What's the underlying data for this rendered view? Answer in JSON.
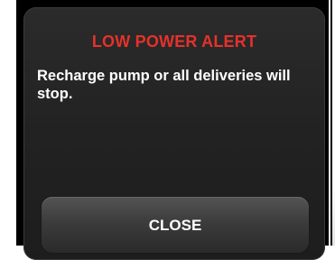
{
  "alert": {
    "title": "LOW POWER ALERT",
    "message": "Recharge pump or all deliveries will stop.",
    "close_label": "CLOSE"
  },
  "colors": {
    "title": "#e4322b",
    "text": "#ffffff",
    "dialog_bg": "#222222",
    "button_bg": "#3c3c3c",
    "frame": "#000000"
  }
}
